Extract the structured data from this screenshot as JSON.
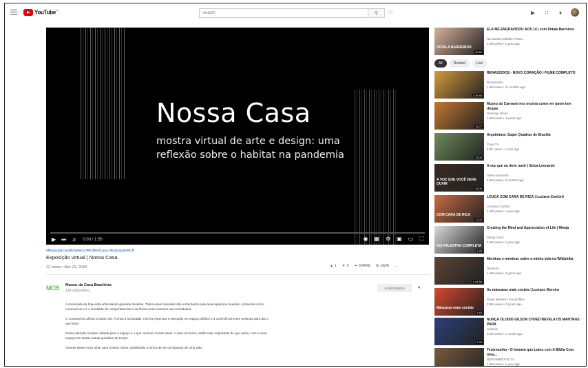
{
  "header": {
    "logo_text": "YouTube",
    "logo_country": "PT",
    "search_placeholder": "Search",
    "search_icon": "search-icon",
    "icons": [
      "create-video-icon",
      "apps-grid-icon",
      "notifications-bell-icon",
      "account-avatar"
    ]
  },
  "player": {
    "title_line": "Nossa Casa",
    "subtitle_line": "mostra virtual de arte e design: uma reflexão sobre o habitat na pandemia",
    "time": "0:00 / 1:56",
    "progress": 0.0
  },
  "video": {
    "hashtags": "#MuseudaCasaBrasileira #MCBemCasa #ExposiçãoMCB",
    "title": "Exposição virtual | Nossa Casa",
    "meta": "12 views • Dec 21, 2020",
    "likes": "1",
    "dislikes": "0",
    "share_label": "SHARE",
    "save_label": "SAVE",
    "more_label": "..."
  },
  "channel": {
    "avatar_text": "MCB",
    "name": "Museu da Casa Brasileira",
    "subs": "12K subscribers",
    "subscribe_label": "SUBSCRIBED"
  },
  "description": [
    "A sociedade de hoje está enfrentando grandes desafios. Todos esses desafios são enfrentados pela atual epidemia mundial, conhecida como coronavírus e é o resultado do comportamento e da forma como vivemos nas sociedades.",
    "O coronavírus afetou a todos nós. Fomos a sociedade, nos fez repensar a interação no espaço público e a convivência entre pessoas para dar o que fazer.",
    "Nossa atenção sempre voltada para o espaço e o que vivemos mundo atual. A casa em torno, então mais importante do que antes, com o casa espaço em tantas outras questões de tempo.",
    "Através desse novo olhar para nossos vasos, analisando a forma de ver os espaços de uma vida"
  ],
  "sidebar": {
    "chips": [
      "All",
      "Related",
      "Live"
    ],
    "recs": [
      {
        "title": "ELA ME ENGRAVIDOU AOS 14 | com Pétala Barreiros",
        "channel": "Na Sandra Bellado Pedra...",
        "views": "1.4M views • 1 year ago",
        "duration": "40:20",
        "thumb": "PÉTALA BARREIROS",
        "color": "#d7b09a"
      },
      {
        "title": "RENASCIDOS - NOVO CORAÇÃO | FILME COMPLETO",
        "channel": "Renascidos",
        "views": "1.6M views • 11 months ago",
        "duration": "1:36:48",
        "thumb": "",
        "color": "#d49a3a"
      },
      {
        "title": "Museu do Carnaval nos mostra como ver quem tem drogas",
        "channel": "Domingo Show",
        "views": "1.2M views • 4 years ago",
        "duration": "14:27",
        "thumb": "",
        "color": "#c4782f"
      },
      {
        "title": "Arquitetura: Super Quadras de Brasília",
        "channel": "Casa TV",
        "views": "6.8K views • 1 year ago",
        "duration": "13:09",
        "thumb": "",
        "color": "#6f8c5b"
      },
      {
        "title": "A voz que ou deve ouvir | Selva Leonardo",
        "channel": "Selva Leonardo",
        "views": "3.4M views • 5 months ago",
        "duration": "32:00",
        "thumb": "A VOZ QUE VOCÊ DEVE OUVIR",
        "color": "#3a2a22"
      },
      {
        "title": "LOUCA COM CARA DE RICA | Luciana Conforti",
        "channel": "Luciana Conforti",
        "views": "1.2M views • 1 year ago",
        "duration": "17:20",
        "thumb": "COM CARA DE RICA",
        "color": "#c96a42"
      },
      {
        "title": "Creating the Mind and Appreciation of Life | Monja",
        "channel": "Monja Coen",
        "views": "3.4M views • 1 year ago",
        "duration": "1:46",
        "thumb": "#18 PALESTRA COMPLETA",
        "color": "#d9d9d9"
      },
      {
        "title": "Mentiras e mentiras sobre a minha vida na Wikipédia",
        "channel": "Diversos",
        "views": "1.2M views • 2 years ago",
        "duration": "1:44:58",
        "thumb": "",
        "color": "#5b4433"
      },
      {
        "title": "As máscaras mais sociais | Luciano Moreira",
        "channel": "Paulo Moreira • GoodOffice",
        "views": "226K views • 2 years ago",
        "duration": "1:43",
        "thumb": "Máscaras mais sociais",
        "color": "#d6472e"
      },
      {
        "title": "NUNÇA OLUDIO GILSON CHVED REVELA OS MANTRAS PARA",
        "channel": "Amazon",
        "views": "3.2M views • 1 month ago",
        "duration": "1:39",
        "thumb": "",
        "color": "#2c3f7a"
      },
      {
        "title": "Testemunho - O homem que Lutou com A Bíblia Com Uma...",
        "channel": "DEPOIMENTOS TV",
        "views": "1.2M views • 1 year ago",
        "duration": "29:10",
        "thumb": "",
        "color": "#7a5b3c"
      }
    ]
  }
}
